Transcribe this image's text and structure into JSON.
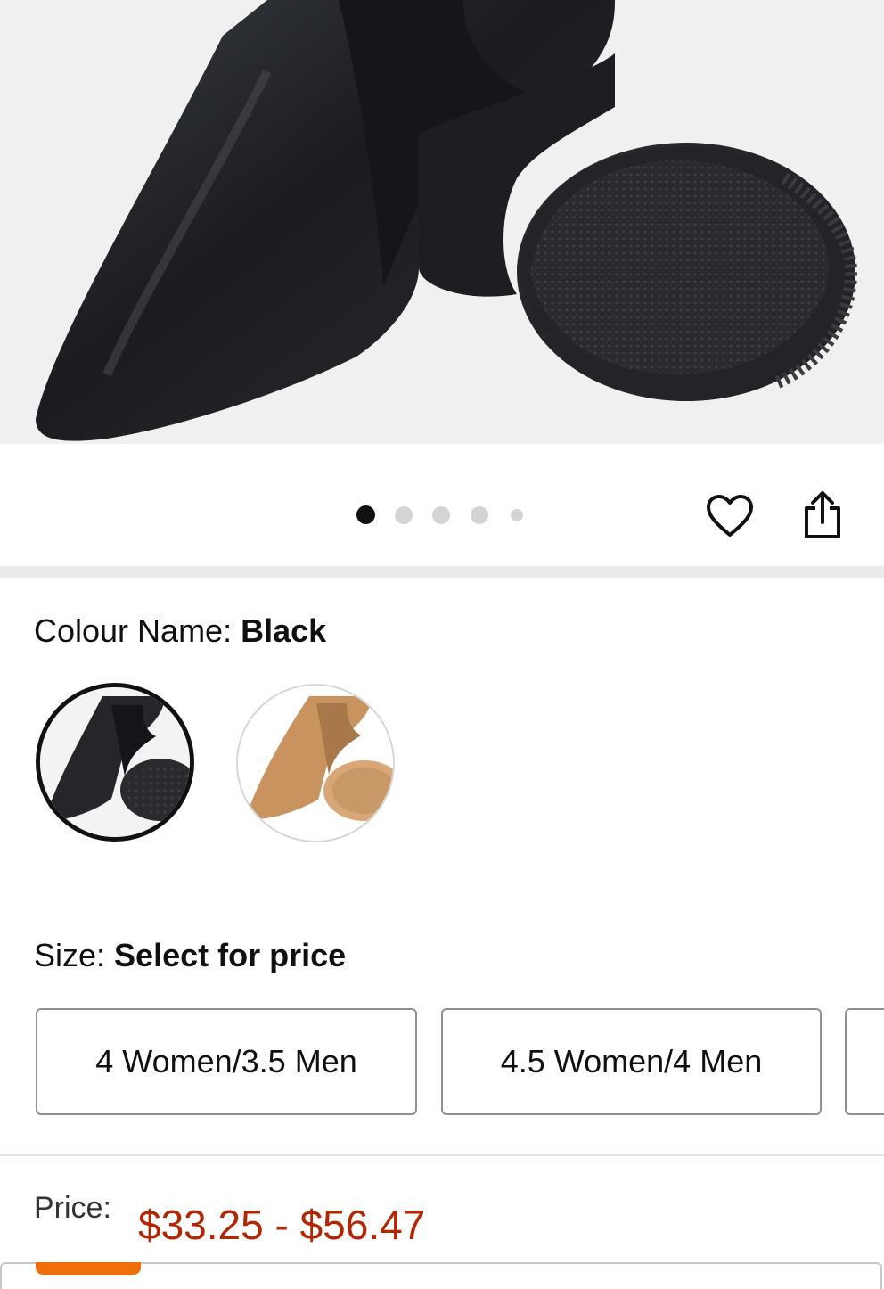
{
  "product_image": {
    "alt": "black jazz shoes"
  },
  "gallery": {
    "dot_count": 5,
    "active_index": 0
  },
  "actions": {
    "wishlist_icon": "heart-outline-icon",
    "share_icon": "share-icon"
  },
  "colour": {
    "label": "Colour Name: ",
    "selected_value": "Black",
    "options": [
      {
        "name": "Black",
        "selected": true
      },
      {
        "name": "Tan",
        "selected": false
      }
    ]
  },
  "size": {
    "label": "Size: ",
    "selected_value": "Select for price",
    "options": [
      {
        "label": "4 Women/3.5 Men"
      },
      {
        "label": "4.5 Women/4 Men"
      }
    ]
  },
  "price": {
    "label": "Price:",
    "value": "$33.25 - $56.47"
  },
  "colors": {
    "price_red": "#b12704",
    "accent_orange": "#f06e0a",
    "selected_border": "#111111"
  }
}
